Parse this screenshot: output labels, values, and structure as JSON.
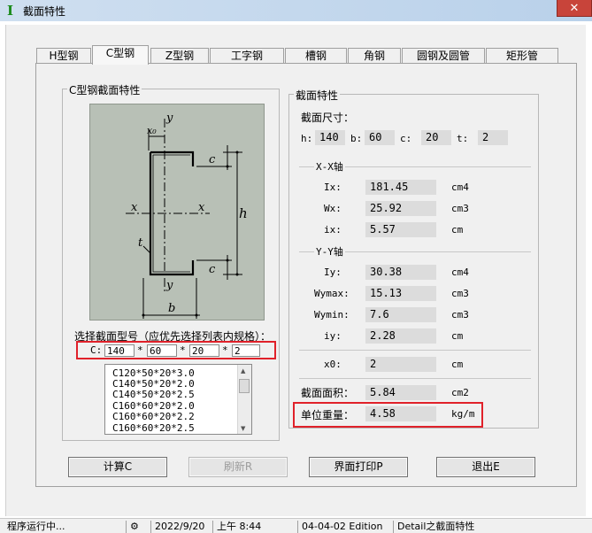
{
  "window": {
    "title": "截面特性",
    "close_label": "✕"
  },
  "tabs": [
    {
      "label": "H型钢"
    },
    {
      "label": "C型钢"
    },
    {
      "label": "Z型钢"
    },
    {
      "label": "工字钢"
    },
    {
      "label": "槽钢"
    },
    {
      "label": "角钢"
    },
    {
      "label": "圆钢及圆管"
    },
    {
      "label": "矩形管"
    }
  ],
  "active_tab": "C型钢",
  "left_group": {
    "title": "C型钢截面特性",
    "diagram_labels": {
      "y_top": "y",
      "x0": "x₀",
      "c_top": "c",
      "x_left": "x",
      "x_right": "x",
      "h": "h",
      "t": "t",
      "c_bottom": "c",
      "y_bottom": "y",
      "b": "b"
    },
    "select_label": "选择截面型号（应优先选择列表内规格）：",
    "spec_prefix": "C:",
    "spec_inputs": [
      "140",
      "60",
      "20",
      "2"
    ],
    "spec_sep": "*",
    "list_items": [
      "C120*50*20*3.0",
      "C140*50*20*2.0",
      "C140*50*20*2.5",
      "C160*60*20*2.0",
      "C160*60*20*2.2",
      "C160*60*20*2.5"
    ]
  },
  "right_group": {
    "title": "截面特性",
    "dims_label": "截面尺寸：",
    "dims": [
      {
        "label": "h:",
        "value": "140"
      },
      {
        "label": "b:",
        "value": "60"
      },
      {
        "label": "c:",
        "value": "20"
      },
      {
        "label": "t:",
        "value": "2"
      }
    ],
    "xx_title": "X-X轴",
    "xx_rows": [
      {
        "label": "Ix:",
        "value": "181.45",
        "unit": "cm4"
      },
      {
        "label": "Wx:",
        "value": "25.92",
        "unit": "cm3"
      },
      {
        "label": "ix:",
        "value": "5.57",
        "unit": "cm"
      }
    ],
    "yy_title": "Y-Y轴",
    "yy_rows": [
      {
        "label": "Iy:",
        "value": "30.38",
        "unit": "cm4"
      },
      {
        "label": "Wymax:",
        "value": "15.13",
        "unit": "cm3"
      },
      {
        "label": "Wymin:",
        "value": "7.6",
        "unit": "cm3"
      },
      {
        "label": "iy:",
        "value": "2.28",
        "unit": "cm"
      }
    ],
    "x0": {
      "label": "x0:",
      "value": "2",
      "unit": "cm"
    },
    "area": {
      "label": "截面面积：",
      "value": "5.84",
      "unit": "cm2"
    },
    "weight": {
      "label": "单位重量：",
      "value": "4.58",
      "unit": "kg/m"
    }
  },
  "buttons": {
    "calc": "计算C",
    "refresh": "刷新R",
    "print": "界面打印P",
    "exit": "退出E"
  },
  "statusbar": [
    "程序运行中...",
    "2022/9/20",
    "上午 8:44",
    "04-04-02 Edition",
    "Detail之截面特性"
  ],
  "colors": {
    "highlight": "#e0212a",
    "diagram_bg": "#b8c0b6"
  }
}
